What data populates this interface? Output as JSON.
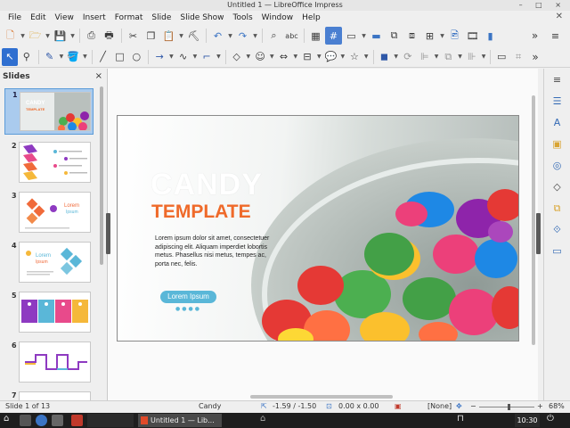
{
  "window": {
    "title": "Untitled 1 — LibreOffice Impress",
    "controls": "– □ ×"
  },
  "menu": [
    "File",
    "Edit",
    "View",
    "Insert",
    "Format",
    "Slide",
    "Slide Show",
    "Tools",
    "Window",
    "Help"
  ],
  "toolbar1_icons": [
    "new-icon",
    "open-icon",
    "save-icon",
    "export-pdf-icon",
    "print-icon",
    "cut-icon",
    "copy-icon",
    "paste-icon",
    "clone-formatting-icon",
    "undo-icon",
    "redo-icon",
    "find-replace-icon",
    "spelling-icon",
    "grid-icon",
    "display-views-icon",
    "master-slide-icon",
    "start-slideshow-icon",
    "start-from-current-icon",
    "table-icon",
    "image-icon",
    "media-icon",
    "chart-icon"
  ],
  "toolbar2_icons": [
    "select-icon",
    "zoom-icon",
    "line-color-icon",
    "fill-color-icon",
    "line-icon",
    "rectangle-icon",
    "ellipse-icon",
    "arrow-line-icon",
    "curve-icon",
    "connector-icon",
    "basic-shapes-icon",
    "symbol-shapes-icon",
    "block-arrows-icon",
    "flowchart-icon",
    "callout-icon",
    "stars-icon",
    "shadow-3d-icon",
    "rotate-icon",
    "align-icon",
    "arrange-icon",
    "distribute-icon",
    "crop-icon",
    "filter-icon"
  ],
  "slides_panel": {
    "title": "Slides",
    "close": "×",
    "slides": [
      {
        "number": "1",
        "selected": true
      },
      {
        "number": "2",
        "selected": false
      },
      {
        "number": "3",
        "selected": false
      },
      {
        "number": "4",
        "selected": false
      },
      {
        "number": "5",
        "selected": false
      },
      {
        "number": "6",
        "selected": false
      },
      {
        "number": "7",
        "selected": false
      }
    ],
    "thumb_text": {
      "s1_title": "CANDY",
      "s1_sub": "TEMPLATE",
      "s3_title": "Lorem",
      "s3_sub": "Ipsum",
      "s4_title": "Lorem",
      "s4_sub": "Ipsum"
    }
  },
  "slide": {
    "title": "CANDY",
    "subtitle": "TEMPLATE",
    "body": "Lorem ipsum dolor sit amet, consectetuer adipiscing elit. Aliquam imperdiet lobortis metus. Phasellus nisi metus, tempes ac, porta nec, felis.",
    "button": "Lorem Ipsum",
    "dots": "●●●●",
    "colors": {
      "title": "#ffffff",
      "subtitle": "#ef6a2a",
      "button": "#5ab7d8"
    }
  },
  "status": {
    "slide": "Slide 1 of 13",
    "master": "Candy",
    "position": "-1.59 / -1.50",
    "size": "0.00 x 0.00",
    "language": "[None]",
    "zoom": "68%"
  },
  "taskbar": {
    "window_label": "Untitled 1 — Lib...",
    "clock": "10:30"
  }
}
